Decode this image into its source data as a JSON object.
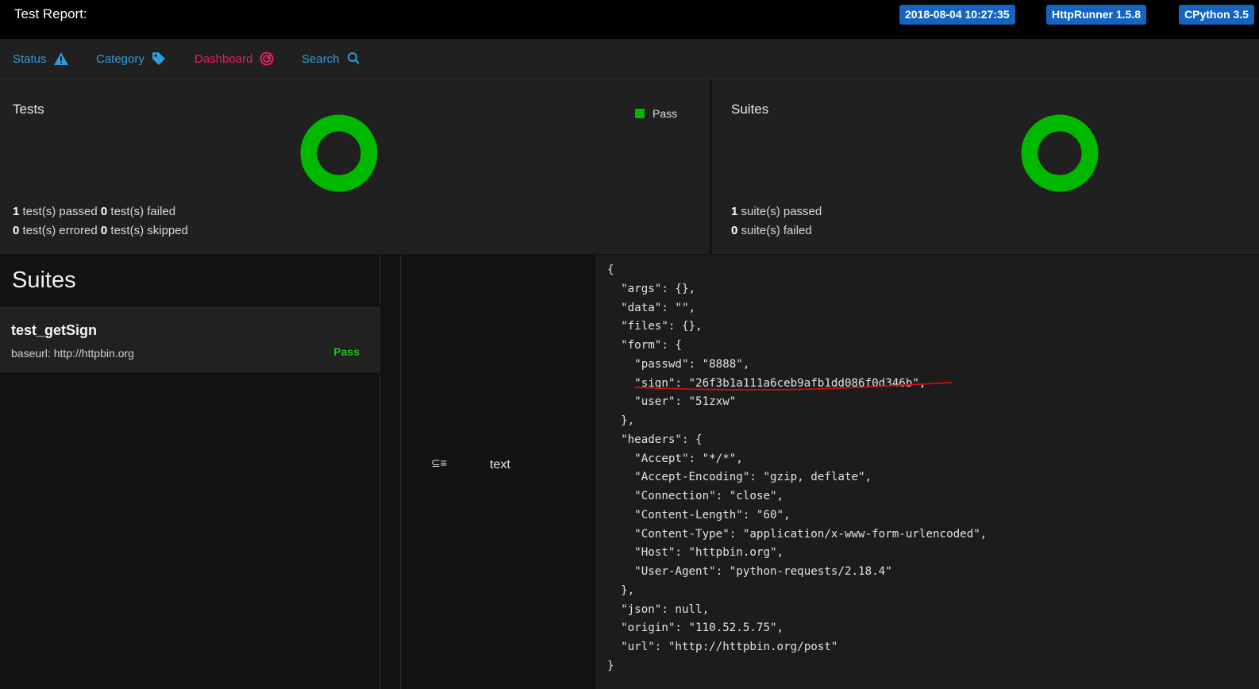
{
  "header": {
    "title": "Test Report:",
    "badges": [
      "2018-08-04 10:27:35",
      "HttpRunner 1.5.8",
      "CPython 3.5"
    ]
  },
  "nav": {
    "status": "Status",
    "category": "Category",
    "dashboard": "Dashboard",
    "search": "Search"
  },
  "tests_card": {
    "title": "Tests",
    "legend": "Pass",
    "passed": "1",
    "passed_label": "test(s) passed",
    "failed": "0",
    "failed_label": "test(s) failed",
    "errored": "0",
    "errored_label": "test(s) errored",
    "skipped": "0",
    "skipped_label": "test(s) skipped"
  },
  "suites_card": {
    "title": "Suites",
    "passed": "1",
    "passed_label": "suite(s) passed",
    "failed": "0",
    "failed_label": "suite(s) failed"
  },
  "suites_panel": {
    "heading": "Suites",
    "items": [
      {
        "name": "test_getSign",
        "baseurl": "baseurl: http://httpbin.org",
        "status": "Pass"
      }
    ]
  },
  "middle": {
    "wrap_icon": "⊆≡",
    "text": "text"
  },
  "response_body": "{\n  \"args\": {},\n  \"data\": \"\",\n  \"files\": {},\n  \"form\": {\n    \"passwd\": \"8888\",\n    \"sign\": \"26f3b1a111a6ceb9afb1dd086f0d346b\",\n    \"user\": \"51zxw\"\n  },\n  \"headers\": {\n    \"Accept\": \"*/*\",\n    \"Accept-Encoding\": \"gzip, deflate\",\n    \"Connection\": \"close\",\n    \"Content-Length\": \"60\",\n    \"Content-Type\": \"application/x-www-form-urlencoded\",\n    \"Host\": \"httpbin.org\",\n    \"User-Agent\": \"python-requests/2.18.4\"\n  },\n  \"json\": null,\n  \"origin\": \"110.52.5.75\",\n  \"url\": \"http://httpbin.org/post\"\n}",
  "colors": {
    "pass_green": "#00b800",
    "badge_blue": "#1565c0",
    "nav_blue": "#2d9cdb",
    "dashboard_red": "#e91e63",
    "annotation_red": "#d01010"
  },
  "icons": {
    "status": "warning-icon",
    "category": "tag-icon",
    "dashboard": "gauge-icon",
    "search": "search-icon"
  }
}
